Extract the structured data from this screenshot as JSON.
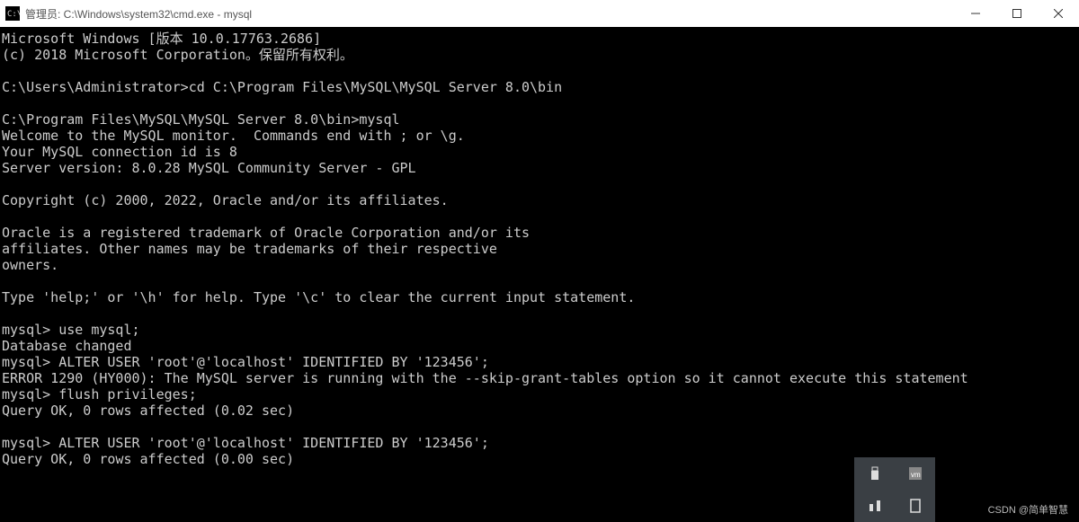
{
  "titlebar": {
    "title": "管理员: C:\\Windows\\system32\\cmd.exe - mysql"
  },
  "terminal": {
    "lines": [
      "Microsoft Windows [版本 10.0.17763.2686]",
      "(c) 2018 Microsoft Corporation。保留所有权利。",
      "",
      "C:\\Users\\Administrator>cd C:\\Program Files\\MySQL\\MySQL Server 8.0\\bin",
      "",
      "C:\\Program Files\\MySQL\\MySQL Server 8.0\\bin>mysql",
      "Welcome to the MySQL monitor.  Commands end with ; or \\g.",
      "Your MySQL connection id is 8",
      "Server version: 8.0.28 MySQL Community Server - GPL",
      "",
      "Copyright (c) 2000, 2022, Oracle and/or its affiliates.",
      "",
      "Oracle is a registered trademark of Oracle Corporation and/or its",
      "affiliates. Other names may be trademarks of their respective",
      "owners.",
      "",
      "Type 'help;' or '\\h' for help. Type '\\c' to clear the current input statement.",
      "",
      "mysql> use mysql;",
      "Database changed",
      "mysql> ALTER USER 'root'@'localhost' IDENTIFIED BY '123456';",
      "ERROR 1290 (HY000): The MySQL server is running with the --skip-grant-tables option so it cannot execute this statement",
      "mysql> flush privileges;",
      "Query OK, 0 rows affected (0.02 sec)",
      "",
      "mysql> ALTER USER 'root'@'localhost' IDENTIFIED BY '123456';",
      "Query OK, 0 rows affected (0.00 sec)"
    ]
  },
  "watermark": "CSDN @简单智慧"
}
